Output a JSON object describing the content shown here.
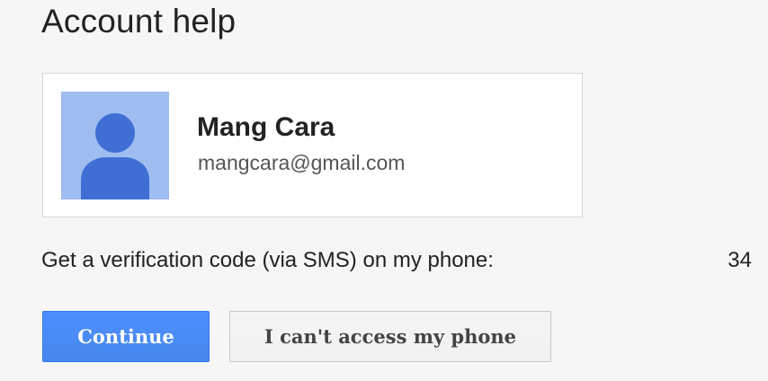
{
  "header": {
    "title": "Account help"
  },
  "account": {
    "avatar_icon": "person-silhouette-icon",
    "name": "Mang Cara",
    "email": "mangcara@gmail.com"
  },
  "verification": {
    "prompt": "Get a verification code (via SMS) on my phone:",
    "phone_suffix": "34"
  },
  "actions": {
    "continue_label": "Continue",
    "cant_access_label": "I can't access my phone"
  },
  "colors": {
    "background": "#f6f6f6",
    "primary_button": "#4d90fe",
    "avatar_background": "#9fbdf0",
    "avatar_silhouette": "#3f6fd4"
  }
}
